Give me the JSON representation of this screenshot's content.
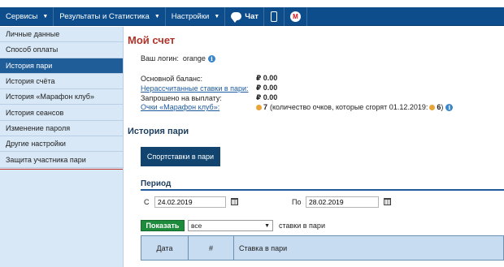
{
  "menu": {
    "services": "Сервисы",
    "results": "Результаты и Статистика",
    "settings": "Настройки",
    "chat": "Чат",
    "m_label": "M"
  },
  "sidebar": {
    "items": [
      {
        "label": "Личные данные"
      },
      {
        "label": "Способ оплаты"
      },
      {
        "label": "История пари",
        "active": true
      },
      {
        "label": "История счёта"
      },
      {
        "label": "История «Марафон клуб»"
      },
      {
        "label": "История сеансов"
      },
      {
        "label": "Изменение пароля"
      },
      {
        "label": "Другие настройки"
      },
      {
        "label": "Защита участника пари"
      }
    ]
  },
  "account": {
    "title": "Мой счет",
    "login_label": "Ваш логин:",
    "login_value": "orange",
    "main_balance_label": "Основной баланс:",
    "main_balance_value": "₽ 0.00",
    "unsettled_label": "Нерассчитанные ставки в пари:",
    "unsettled_value": "₽ 0.00",
    "withdraw_label": "Запрошено на выплату:",
    "withdraw_value": "₽ 0.00",
    "club_points_label": "Очки «Марафон клуб»:",
    "club_points_value": "7",
    "club_points_note": "(количество очков, которые сгорят 01.12.2019:",
    "club_points_expire_value": "6",
    "club_points_close": ")"
  },
  "history": {
    "title": "История пари",
    "sports_button": "Спортставки в пари",
    "period_label": "Период",
    "from_label": "С",
    "from_value": "24.02.2019",
    "to_label": "По",
    "to_value": "28.02.2019",
    "show_button": "Показать",
    "filter_value": "все",
    "filter_suffix": "ставки в пари",
    "columns": [
      "Дата",
      "#",
      "Ставка в пари"
    ]
  },
  "colors": {
    "menubar": "#0d4d8c",
    "sidebar_bg": "#d8e8f6",
    "active_item": "#1f5d99",
    "title_red": "#b0342a",
    "show_green": "#1e8a3c"
  }
}
